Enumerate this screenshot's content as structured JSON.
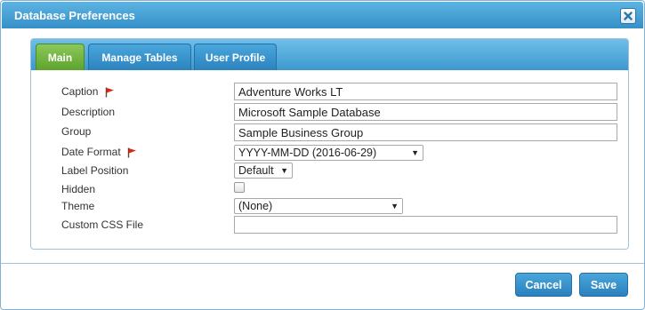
{
  "dialog": {
    "title": "Database Preferences",
    "close_icon": "close-icon"
  },
  "tabs": [
    {
      "label": "Main",
      "active": true
    },
    {
      "label": "Manage Tables",
      "active": false
    },
    {
      "label": "User Profile",
      "active": false
    }
  ],
  "form": {
    "caption": {
      "label": "Caption",
      "value": "Adventure Works LT",
      "required": true
    },
    "description": {
      "label": "Description",
      "value": "Microsoft Sample Database"
    },
    "group": {
      "label": "Group",
      "value": "Sample Business Group"
    },
    "date_format": {
      "label": "Date Format",
      "value": "YYYY-MM-DD (2016-06-29)",
      "required": true
    },
    "label_position": {
      "label": "Label Position",
      "value": "Default"
    },
    "hidden": {
      "label": "Hidden",
      "checked": false
    },
    "theme": {
      "label": "Theme",
      "value": "(None)"
    },
    "custom_css": {
      "label": "Custom CSS File",
      "value": ""
    }
  },
  "buttons": {
    "cancel": "Cancel",
    "save": "Save"
  },
  "colors": {
    "accent": "#3590c8",
    "active_tab": "#5ea32d",
    "required_flag": "#d9261c"
  }
}
